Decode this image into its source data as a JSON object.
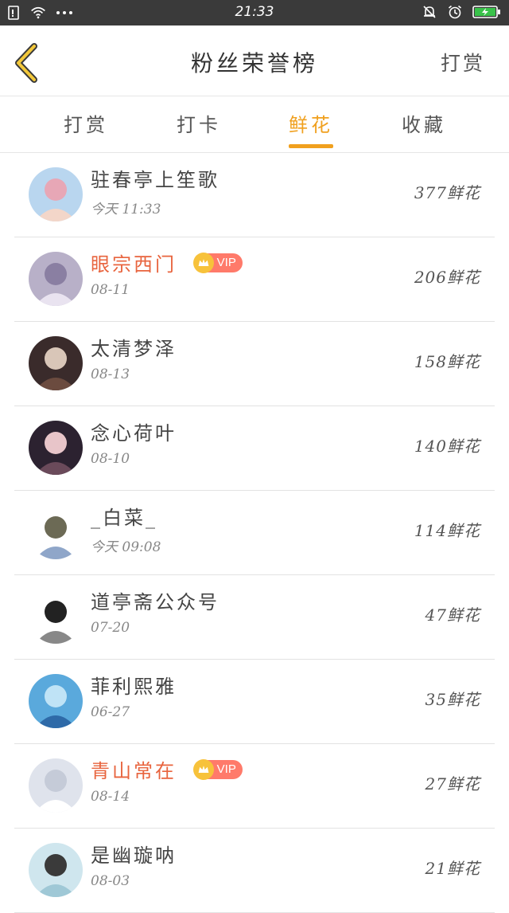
{
  "status_bar": {
    "time": "21:33",
    "icons": [
      "sim-icon",
      "wifi-icon",
      "more-dots-icon",
      "bell-muted-icon",
      "alarm-icon",
      "battery-charging-icon"
    ]
  },
  "header": {
    "title": "粉丝荣誉榜",
    "action_label": "打赏",
    "back_icon": "chevron-left-icon",
    "accent_color": "#f0a01e"
  },
  "tabs": [
    {
      "label": "打赏",
      "active": false
    },
    {
      "label": "打卡",
      "active": false
    },
    {
      "label": "鲜花",
      "active": true
    },
    {
      "label": "收藏",
      "active": false
    }
  ],
  "vip_badge_label": "VIP",
  "fans": [
    {
      "name": "驻春亭上笙歌",
      "date": "今天 11:33",
      "amount": "377鲜花",
      "vip": false,
      "avatar_colors": [
        "#b9d6ef",
        "#e7a7b6",
        "#f3d6c9"
      ]
    },
    {
      "name": "眼宗西门",
      "date": "08-11",
      "amount": "206鲜花",
      "vip": true,
      "avatar_colors": [
        "#b8b0c8",
        "#8a7fa2",
        "#e9e3f0"
      ]
    },
    {
      "name": "太清梦泽",
      "date": "08-13",
      "amount": "158鲜花",
      "vip": false,
      "avatar_colors": [
        "#3a2b2b",
        "#d9c6b8",
        "#6b4b3f"
      ]
    },
    {
      "name": "念心荷叶",
      "date": "08-10",
      "amount": "140鲜花",
      "vip": false,
      "avatar_colors": [
        "#2c2230",
        "#e8c5c9",
        "#6a4a5a"
      ]
    },
    {
      "name": "_白菜_",
      "date": "今天 09:08",
      "amount": "114鲜花",
      "vip": false,
      "avatar_colors": [
        "#ffffff",
        "#6c6a55",
        "#8fa6c9"
      ]
    },
    {
      "name": "道亭斋公众号",
      "date": "07-20",
      "amount": "47鲜花",
      "vip": false,
      "avatar_colors": [
        "#ffffff",
        "#222222",
        "#888888"
      ]
    },
    {
      "name": "菲利熙雅",
      "date": "06-27",
      "amount": "35鲜花",
      "vip": false,
      "avatar_colors": [
        "#5aa9dc",
        "#bfe3f6",
        "#2e6aa8"
      ]
    },
    {
      "name": "青山常在",
      "date": "08-14",
      "amount": "27鲜花",
      "vip": true,
      "avatar_colors": [
        "#dfe3ec",
        "#c5cbd8",
        "#ffffff"
      ]
    },
    {
      "name": "是幽璇呐",
      "date": "08-03",
      "amount": "21鲜花",
      "vip": false,
      "avatar_colors": [
        "#cfe6ee",
        "#3a3a3a",
        "#9fc8d6"
      ]
    }
  ]
}
